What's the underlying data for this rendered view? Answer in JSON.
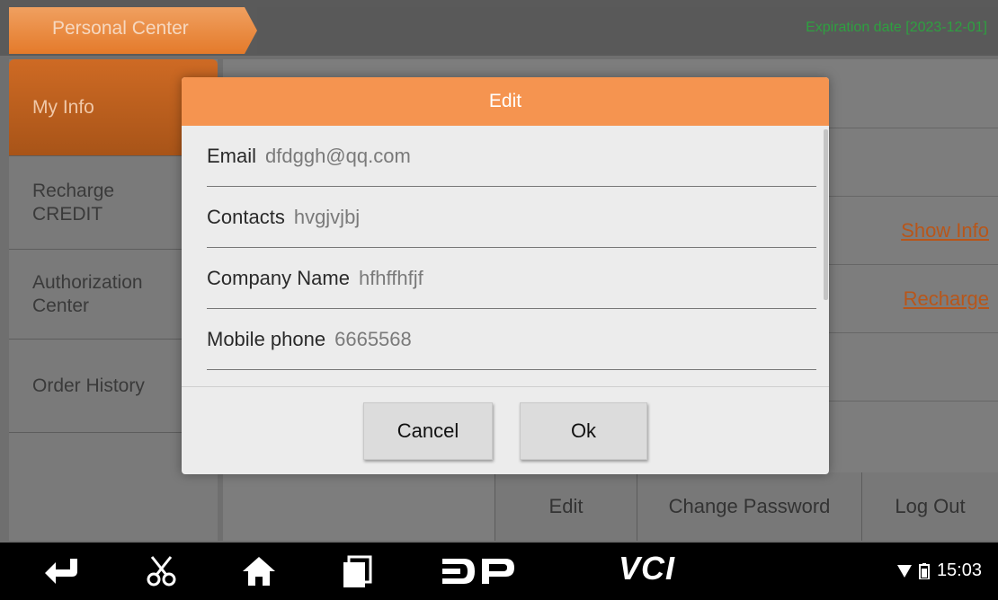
{
  "header": {
    "tab_title": "Personal Center",
    "expiration": "Expiration date [2023-12-01]"
  },
  "sidebar": {
    "items": [
      {
        "label": "My Info",
        "active": true
      },
      {
        "label": "Recharge CREDIT",
        "active": false
      },
      {
        "label": "Authorization Center",
        "active": false
      },
      {
        "label": "Order History",
        "active": false
      }
    ]
  },
  "main": {
    "show_info_link": "Show Info",
    "recharge_link": "Recharge",
    "buttons": {
      "edit": "Edit",
      "change_password": "Change Password",
      "log_out": "Log Out"
    }
  },
  "dialog": {
    "title": "Edit",
    "fields": [
      {
        "label": "Email",
        "value": "dfdggh@qq.com"
      },
      {
        "label": "Contacts",
        "value": "hvgjvjbj"
      },
      {
        "label": "Company Name",
        "value": "hfhffhfjf"
      },
      {
        "label": "Mobile phone",
        "value": "6665568"
      }
    ],
    "cancel_label": "Cancel",
    "ok_label": "Ok"
  },
  "navbar": {
    "icons": [
      "back-icon",
      "scissors-icon",
      "home-icon",
      "recent-apps-icon",
      "dp-logo-icon",
      "vci-logo-icon"
    ],
    "vci_text": "VCI",
    "time": "15:03"
  },
  "colors": {
    "accent": "#f59450",
    "link": "#b8561a",
    "expiration": "#2ea040"
  }
}
